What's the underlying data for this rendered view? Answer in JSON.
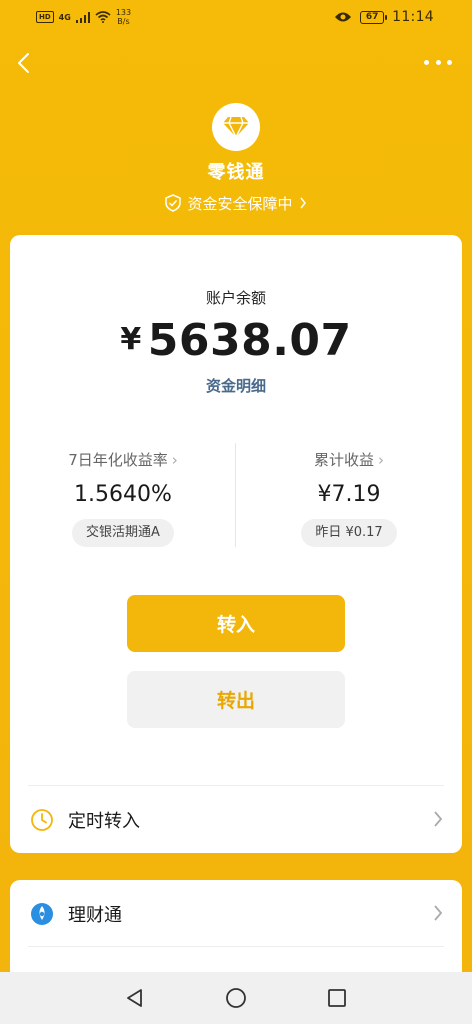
{
  "status_bar": {
    "hd": "HD",
    "signal": "4G",
    "speed_value": "133",
    "speed_unit": "B/s",
    "battery": "67",
    "time": "11:14"
  },
  "header": {
    "title": "零钱通",
    "safety_text": "资金安全保障中",
    "back_icon": "chevron-left-icon",
    "more_icon": "more-dots-icon",
    "logo_icon": "diamond-icon"
  },
  "balance": {
    "label": "账户余额",
    "currency": "¥",
    "amount": "5638.07",
    "detail_link": "资金明细"
  },
  "stats": {
    "yield_label": "7日年化收益率",
    "yield_value": "1.5640%",
    "fund_name": "交银活期通A",
    "earnings_label": "累计收益",
    "earnings_value": "¥7.19",
    "yesterday": "昨日 ¥0.17"
  },
  "actions": {
    "transfer_in": "转入",
    "transfer_out": "转出"
  },
  "rows": {
    "scheduled": "定时转入",
    "wealth": "理财通"
  },
  "colors": {
    "brand_yellow": "#f3b60b",
    "link_blue": "#4a6a8c",
    "wealth_blue": "#2a8fe0"
  }
}
